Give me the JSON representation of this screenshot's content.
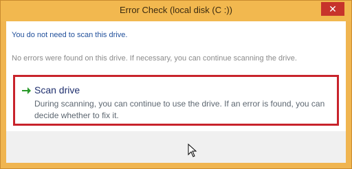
{
  "window": {
    "title": "Error Check (local disk (C :))",
    "close_symbol": "✕"
  },
  "message": {
    "headline": "You do not need to scan this drive.",
    "info": "No errors were found on this drive. If necessary, you can continue scanning the drive."
  },
  "scan_option": {
    "icon": "green-arrow-icon",
    "title": "Scan drive",
    "description": "During scanning, you can continue to use the drive. If an error is found, you can decide whether to fix it."
  },
  "colors": {
    "highlight_border": "#c8232b",
    "headline": "#1f4e9a",
    "arrow": "#2a9a2a"
  }
}
